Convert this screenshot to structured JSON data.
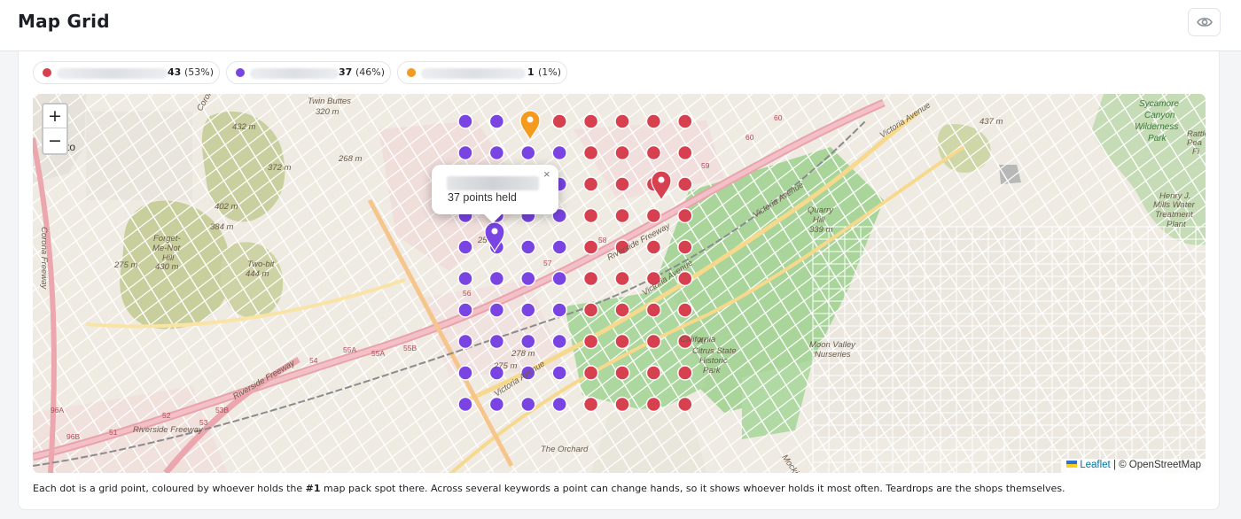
{
  "header": {
    "title": "Map Grid",
    "visibility_icon": "eye-icon"
  },
  "legend": [
    {
      "color": "#d6404f",
      "count": "43",
      "pct": "(53%)"
    },
    {
      "color": "#7a44e2",
      "count": "37",
      "pct": "(46%)"
    },
    {
      "color": "#f39a1f",
      "count": "1",
      "pct": "(1%)"
    }
  ],
  "map": {
    "zoom_in": "+",
    "zoom_out": "−",
    "labels": [
      {
        "text": "Twin Buttes"
      },
      {
        "text": "320 m"
      },
      {
        "text": "432 m"
      },
      {
        "text": "268 m"
      },
      {
        "text": "372 m"
      },
      {
        "text": "402 m"
      },
      {
        "text": "384 m"
      },
      {
        "text": "Forget-"
      },
      {
        "text": "Me-Not"
      },
      {
        "text": "Hill"
      },
      {
        "text": "430 m"
      },
      {
        "text": "275 m"
      },
      {
        "text": "Two-bit"
      },
      {
        "text": "444 m"
      },
      {
        "text": "437 m"
      },
      {
        "text": "Sycamore"
      },
      {
        "text": "Canyon"
      },
      {
        "text": "Wilderness"
      },
      {
        "text": "Park"
      },
      {
        "text": "Rattle"
      },
      {
        "text": "Pea"
      },
      {
        "text": "Fi"
      },
      {
        "text": "Henry J."
      },
      {
        "text": "Mills Water"
      },
      {
        "text": "Treatment"
      },
      {
        "text": "Plant"
      },
      {
        "text": "Quarry"
      },
      {
        "text": "Hill"
      },
      {
        "text": "339 m"
      },
      {
        "text": "Moon Valley"
      },
      {
        "text": "Nurseries"
      },
      {
        "text": "The Orchard"
      },
      {
        "text": "Victoria Avenue"
      },
      {
        "text": "Victoria Avenue"
      },
      {
        "text": "Victoria Avenue"
      },
      {
        "text": "Victoria Avenue"
      },
      {
        "text": "Riverside Freeway"
      },
      {
        "text": "Riverside Freeway"
      },
      {
        "text": "Riverside Freeway"
      },
      {
        "text": "Corona Freeway"
      },
      {
        "text": "Corona Freeway"
      },
      {
        "text": "Mockingbird"
      },
      {
        "text": "Citrus State"
      },
      {
        "text": "Historic"
      },
      {
        "text": "Park"
      },
      {
        "text": "California"
      },
      {
        "text": "Ar"
      },
      {
        "text": "278 m"
      },
      {
        "text": "275 m"
      },
      {
        "text": "25"
      },
      {
        "text": "to"
      },
      {
        "text": "60"
      },
      {
        "text": "60"
      },
      {
        "text": "59"
      },
      {
        "text": "58"
      },
      {
        "text": "57"
      },
      {
        "text": "56"
      },
      {
        "text": "55A"
      },
      {
        "text": "55A"
      },
      {
        "text": "55B"
      },
      {
        "text": "54"
      },
      {
        "text": "53B"
      },
      {
        "text": "53"
      },
      {
        "text": "52"
      },
      {
        "text": "51"
      },
      {
        "text": "96A"
      },
      {
        "text": "96B"
      }
    ],
    "grid": {
      "colors": {
        "r": "#d6404f",
        "p": "#7a44e2"
      },
      "rows": [
        "pp.rrrrr",
        "pppprrrr",
        "pppprrrr",
        "pppprrrr",
        "pppprrrr",
        "pppprrrr",
        "pppprrrr",
        "pppprrrr",
        "pppprrrr",
        "pppprrrr"
      ]
    },
    "markers": [
      {
        "color": "#f39a1f",
        "icon": "map-pin-icon"
      },
      {
        "color": "#d6404f",
        "icon": "map-pin-icon"
      },
      {
        "color": "#7a44e2",
        "icon": "map-pin-icon"
      }
    ],
    "popup": {
      "text": "37 points held",
      "close": "×"
    },
    "attribution": {
      "leaflet": "Leaflet",
      "sep": " | ",
      "osm": "© OpenStreetMap"
    }
  },
  "caption": {
    "before": "Each dot is a grid point, coloured by whoever holds the ",
    "bold": "#1",
    "after": " map pack spot there. Across several keywords a point can change hands, so it shows whoever holds it most often. Teardrops are the shops themselves."
  }
}
